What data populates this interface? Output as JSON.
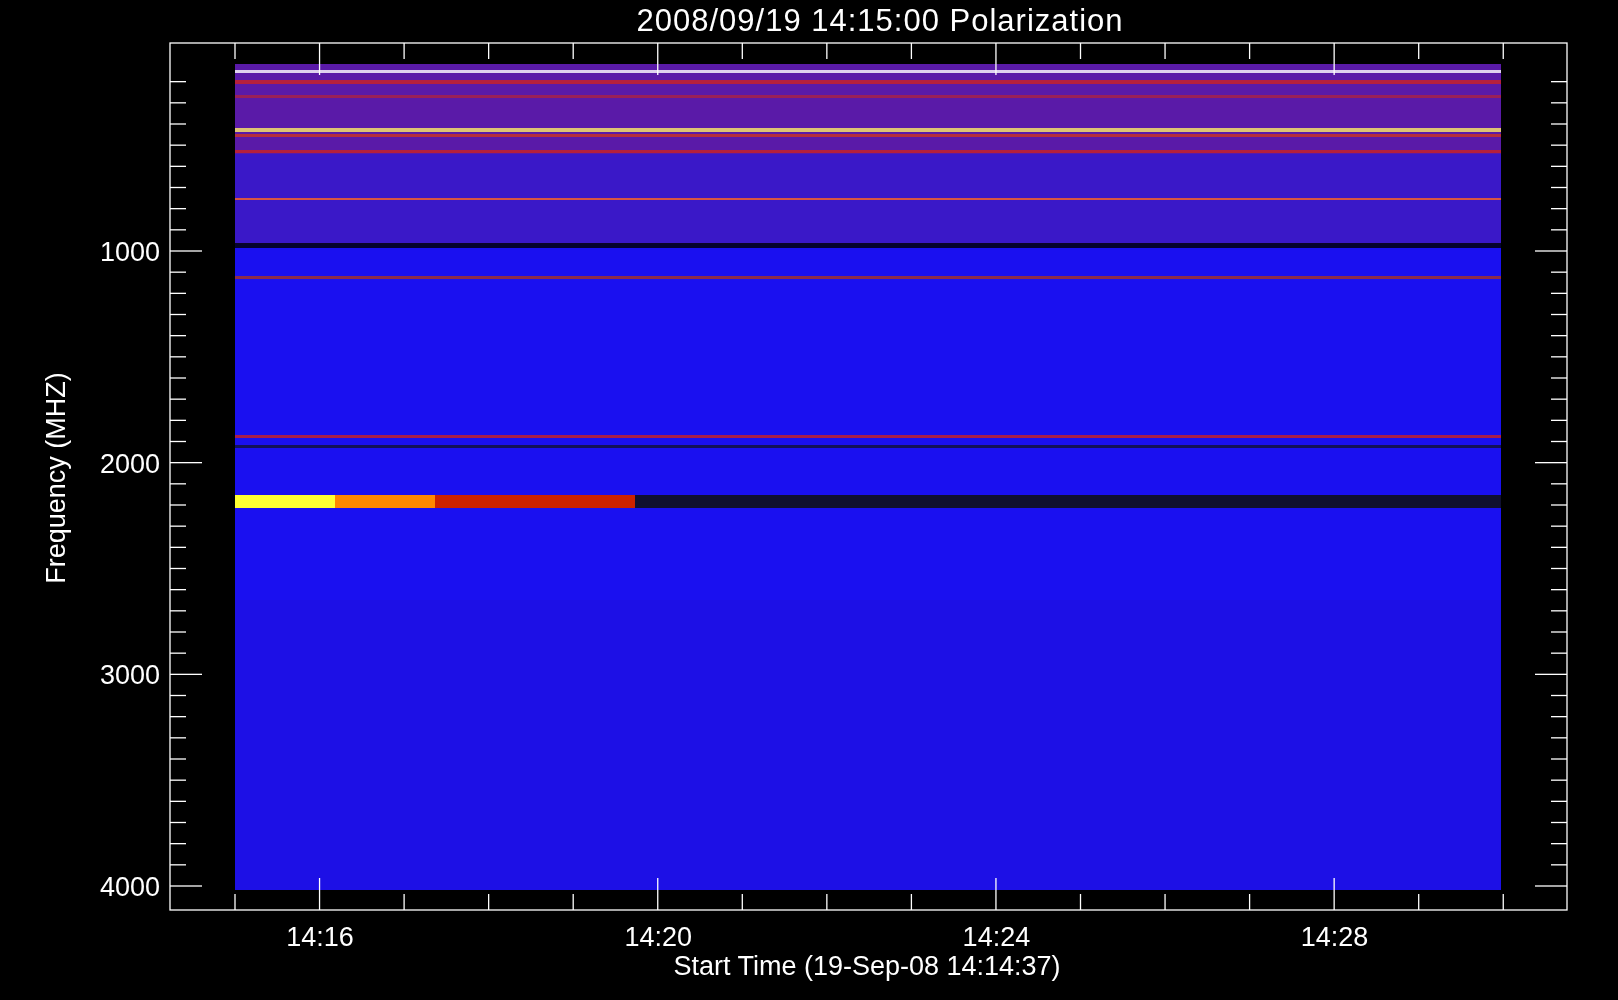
{
  "title": "2008/09/19 14:15:00 Polarization",
  "y_axis": {
    "label": "Frequency (MHZ)",
    "ticks": [
      "1000",
      "2000",
      "3000",
      "4000"
    ]
  },
  "x_axis": {
    "label": "Start Time (19-Sep-08 14:14:37)",
    "ticks": [
      "14:16",
      "14:20",
      "14:24",
      "14:28"
    ]
  }
}
